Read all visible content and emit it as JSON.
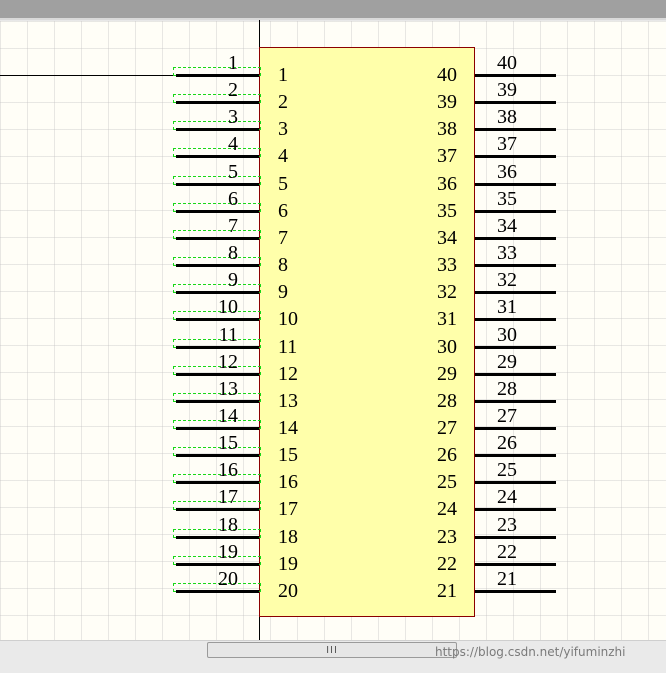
{
  "pins_left": [
    "1",
    "2",
    "3",
    "4",
    "5",
    "6",
    "7",
    "8",
    "9",
    "10",
    "11",
    "12",
    "13",
    "14",
    "15",
    "16",
    "17",
    "18",
    "19",
    "20"
  ],
  "pins_right": [
    "40",
    "39",
    "38",
    "37",
    "36",
    "35",
    "34",
    "33",
    "32",
    "31",
    "30",
    "29",
    "28",
    "27",
    "26",
    "25",
    "24",
    "23",
    "22",
    "21"
  ],
  "scrollbar_grip": "III",
  "watermark": "https://blog.csdn.net/yifuminzhi",
  "colors": {
    "component_fill": "#ffffaa",
    "component_border": "#8b0000",
    "selection_dash": "#19d819"
  }
}
